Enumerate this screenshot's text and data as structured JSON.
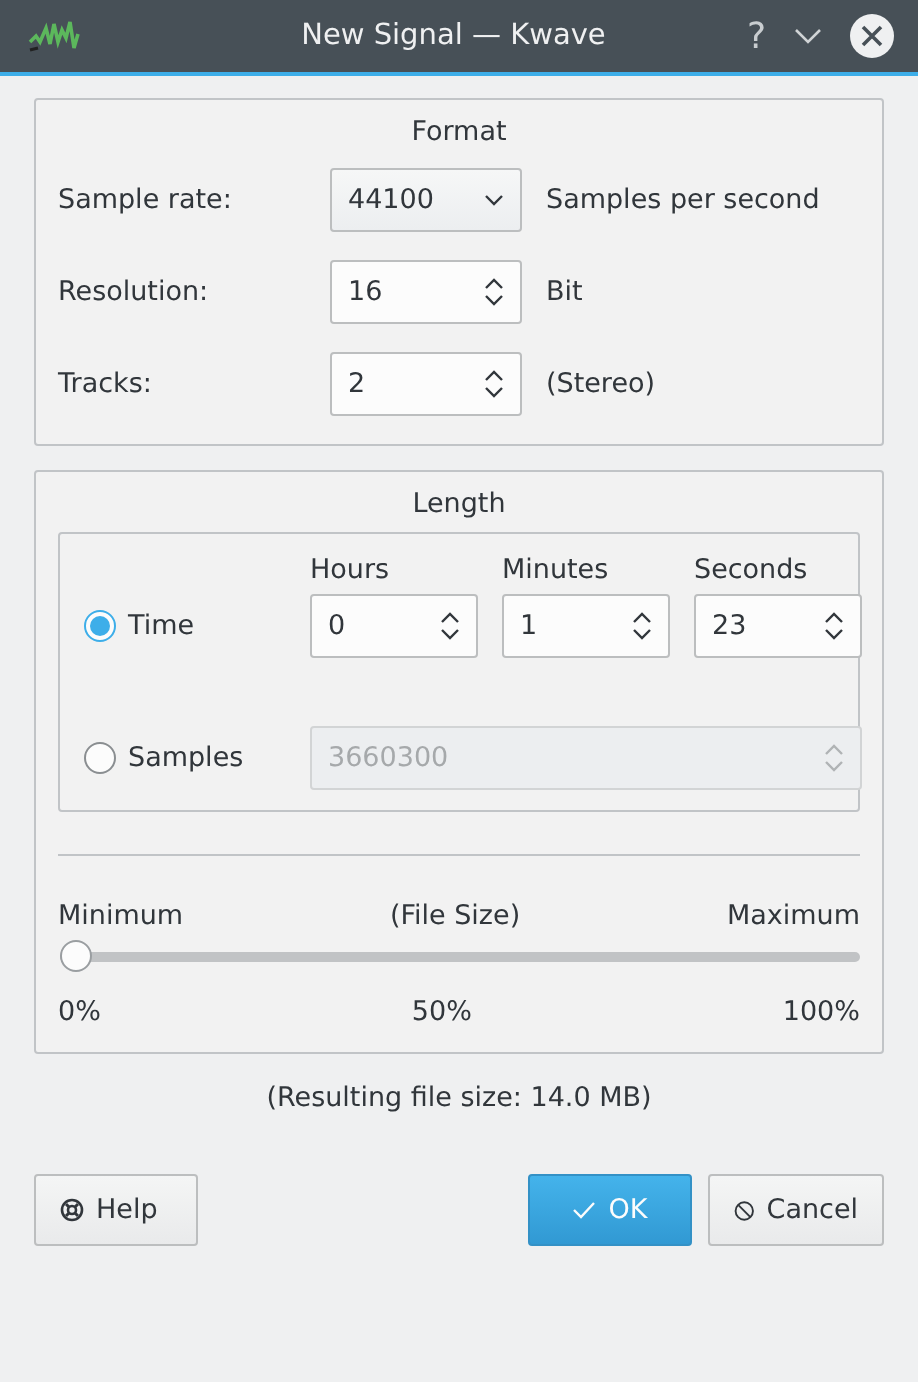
{
  "window": {
    "title": "New Signal — Kwave",
    "help_glyph": "?"
  },
  "format": {
    "title": "Format",
    "rows": [
      {
        "kind": "combo",
        "label": "Sample rate:",
        "value": "44100",
        "unit": "Samples per second"
      },
      {
        "kind": "spin",
        "label": "Resolution:",
        "value": "16",
        "unit": "Bit"
      },
      {
        "kind": "spin",
        "label": "Tracks:",
        "value": "2",
        "unit": "(Stereo)"
      }
    ]
  },
  "length": {
    "title": "Length",
    "columns": [
      "Hours",
      "Minutes",
      "Seconds"
    ],
    "options": [
      {
        "kind": "time",
        "label": "Time",
        "selected": true,
        "fields": [
          "0",
          "1",
          "23"
        ]
      },
      {
        "kind": "samples",
        "label": "Samples",
        "selected": false,
        "value": "3660300",
        "disabled": true
      }
    ],
    "slider": {
      "min_label": "Minimum",
      "caption": "(File Size)",
      "max_label": "Maximum",
      "level": 0,
      "ticks": [
        "0%",
        "50%",
        "100%"
      ]
    }
  },
  "result": "(Resulting file size: 14.0 MB)",
  "buttons": [
    {
      "kind": "help",
      "label": "Help",
      "default": false
    },
    {
      "kind": "ok",
      "label": "OK",
      "default": true
    },
    {
      "kind": "cancel",
      "label": "Cancel",
      "default": false
    }
  ]
}
